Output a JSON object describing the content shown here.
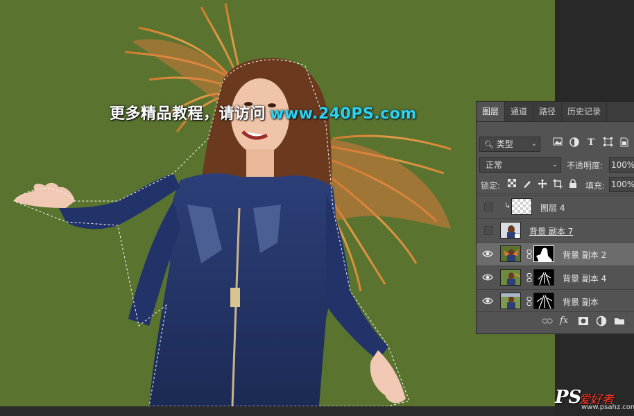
{
  "watermark": {
    "text_cn": "更多精品教程，请访问",
    "url": "www.240PS.com"
  },
  "logo": {
    "ps": "PS",
    "cn": "爱好者",
    "url": "www.psahz.com"
  },
  "colors": {
    "canvas_bg": "#5a7430",
    "panel_bg": "#535353",
    "watermark_url": "#2fd2ef"
  },
  "layers_panel": {
    "tabs": [
      "图层",
      "通道",
      "路径",
      "历史记录"
    ],
    "active_tab": "图层",
    "filter": {
      "icon": "search-icon",
      "label": "类型"
    },
    "blend_mode": "正常",
    "opacity_label": "不透明度:",
    "opacity_value": "100%",
    "lock_label": "锁定:",
    "fill_label": "填充:",
    "fill_value": "100%",
    "layers": [
      {
        "name": "图层 4",
        "visible": false,
        "clipped": true,
        "thumb": "transparent-checker"
      },
      {
        "name": "背景 副本 7",
        "visible": false,
        "clipped": false,
        "thumb": "photo-smart-object"
      },
      {
        "name": "背景 副本 2",
        "visible": true,
        "selected": true,
        "thumb": "photo-with-mask"
      },
      {
        "name": "背景 副本 4",
        "visible": true,
        "thumb": "photo-with-mask"
      },
      {
        "name": "背景 副本",
        "visible": true,
        "thumb": "photo-with-mask"
      }
    ],
    "bottom_tools": [
      "link-icon",
      "fx-icon",
      "add-mask-icon",
      "adjustment-icon",
      "group-folder-icon"
    ]
  }
}
